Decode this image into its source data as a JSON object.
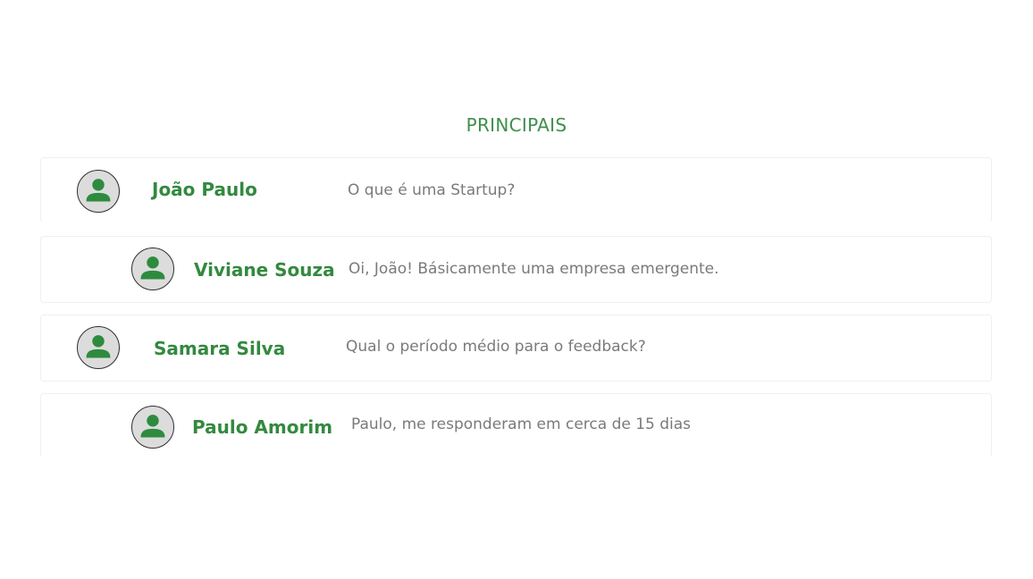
{
  "section": {
    "title": "PRINCIPAIS"
  },
  "comments": [
    {
      "name": "João Paulo",
      "message": "O que é uma Startup?",
      "avatar_icon": "user-icon"
    },
    {
      "name": "Viviane Souza",
      "message": "Oi, João! Básicamente uma empresa emergente.",
      "avatar_icon": "user-icon"
    },
    {
      "name": "Samara Silva",
      "message": "Qual o período médio para o feedback?",
      "avatar_icon": "user-icon"
    },
    {
      "name": "Paulo Amorim",
      "message": "Paulo, me responderam em cerca de 15 dias",
      "avatar_icon": "user-icon"
    }
  ],
  "colors": {
    "accent": "#33893f",
    "message_text": "#7a7a7a",
    "avatar_bg": "#dcdcdc",
    "avatar_figure": "#2e8b3e"
  }
}
